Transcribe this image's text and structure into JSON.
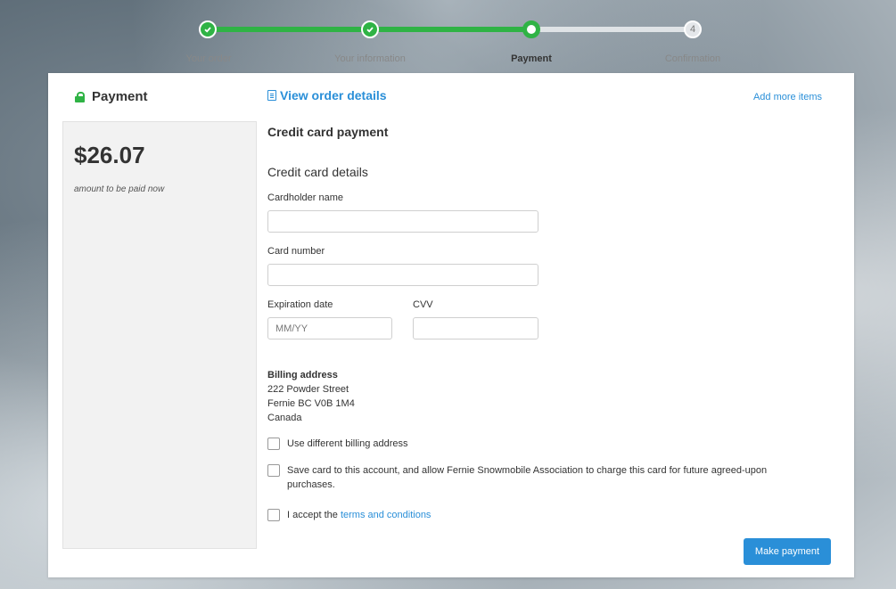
{
  "progress": {
    "steps": [
      {
        "label": "Your order",
        "status": "done"
      },
      {
        "label": "Your information",
        "status": "done"
      },
      {
        "label": "Payment",
        "status": "current"
      },
      {
        "label": "Confirmation",
        "status": "todo",
        "number": "4"
      }
    ]
  },
  "sidebar": {
    "title": "Payment",
    "amount": "$26.07",
    "amount_note": "amount to be paid now"
  },
  "header": {
    "view_order": "View order details",
    "add_more": "Add more items"
  },
  "form": {
    "section_title": "Credit card payment",
    "subsection_title": "Credit card details",
    "cardholder_label": "Cardholder name",
    "cardholder_value": "",
    "card_number_label": "Card number",
    "card_number_value": "",
    "expiration_label": "Expiration date",
    "expiration_placeholder": "MM/YY",
    "cvv_label": "CVV",
    "cvv_value": ""
  },
  "billing": {
    "title": "Billing address",
    "line1": "222 Powder Street",
    "line2": "Fernie BC V0B 1M4",
    "line3": "Canada"
  },
  "checkboxes": {
    "different_billing": "Use different billing address",
    "save_card": "Save card to this account, and allow Fernie Snowmobile Association to charge this card for future agreed-upon purchases.",
    "accept_prefix": "I accept the",
    "terms_link": "terms and conditions"
  },
  "actions": {
    "make_payment": "Make payment"
  },
  "colors": {
    "accent": "#2a8fd8",
    "success": "#2fb345"
  }
}
